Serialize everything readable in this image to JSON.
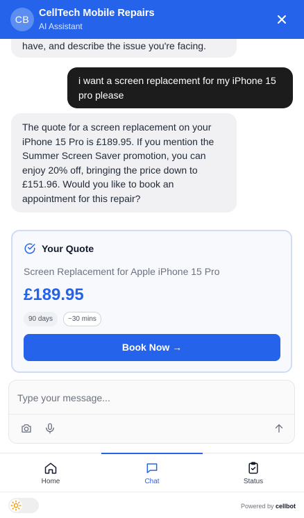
{
  "header": {
    "avatar_initials": "CB",
    "title": "CellTech Mobile Repairs",
    "subtitle": "AI Assistant",
    "close_icon": "close-icon"
  },
  "messages": [
    {
      "role": "bot",
      "text": "have, and describe the issue you're facing."
    },
    {
      "role": "user",
      "line1": "i want a screen replacement for my iPhone 15",
      "line2": "pro please"
    },
    {
      "role": "bot",
      "lines": [
        "The quote for a screen replacement on your",
        "iPhone 15 Pro is £189.95. If you mention the",
        "Summer Screen Saver promotion, you can",
        "enjoy 20% off, bringing the price down to",
        "£151.96. Would you like to book an",
        "appointment for this repair?"
      ]
    }
  ],
  "quote": {
    "heading": "Your Quote",
    "description": "Screen Replacement for Apple iPhone 15 Pro",
    "price": "£189.95",
    "tags": [
      "90 days",
      "~30 mins"
    ],
    "book_label": "Book Now →"
  },
  "composer": {
    "placeholder": "Type your message...",
    "icons": [
      "camera-icon",
      "microphone-icon",
      "send-arrow-icon"
    ]
  },
  "nav": {
    "items": [
      {
        "label": "Home",
        "icon": "home-icon"
      },
      {
        "label": "Chat",
        "icon": "chat-icon"
      },
      {
        "label": "Status",
        "icon": "clipboard-check-icon"
      }
    ],
    "active": "Chat"
  },
  "footer": {
    "powered_prefix": "Powered by",
    "powered_brand": "cellbot",
    "theme_icon": "sun-icon"
  },
  "colors": {
    "accent": "#2563eb",
    "user_bubble": "#1c1c1c",
    "bot_bubble": "#f1f1f3"
  }
}
